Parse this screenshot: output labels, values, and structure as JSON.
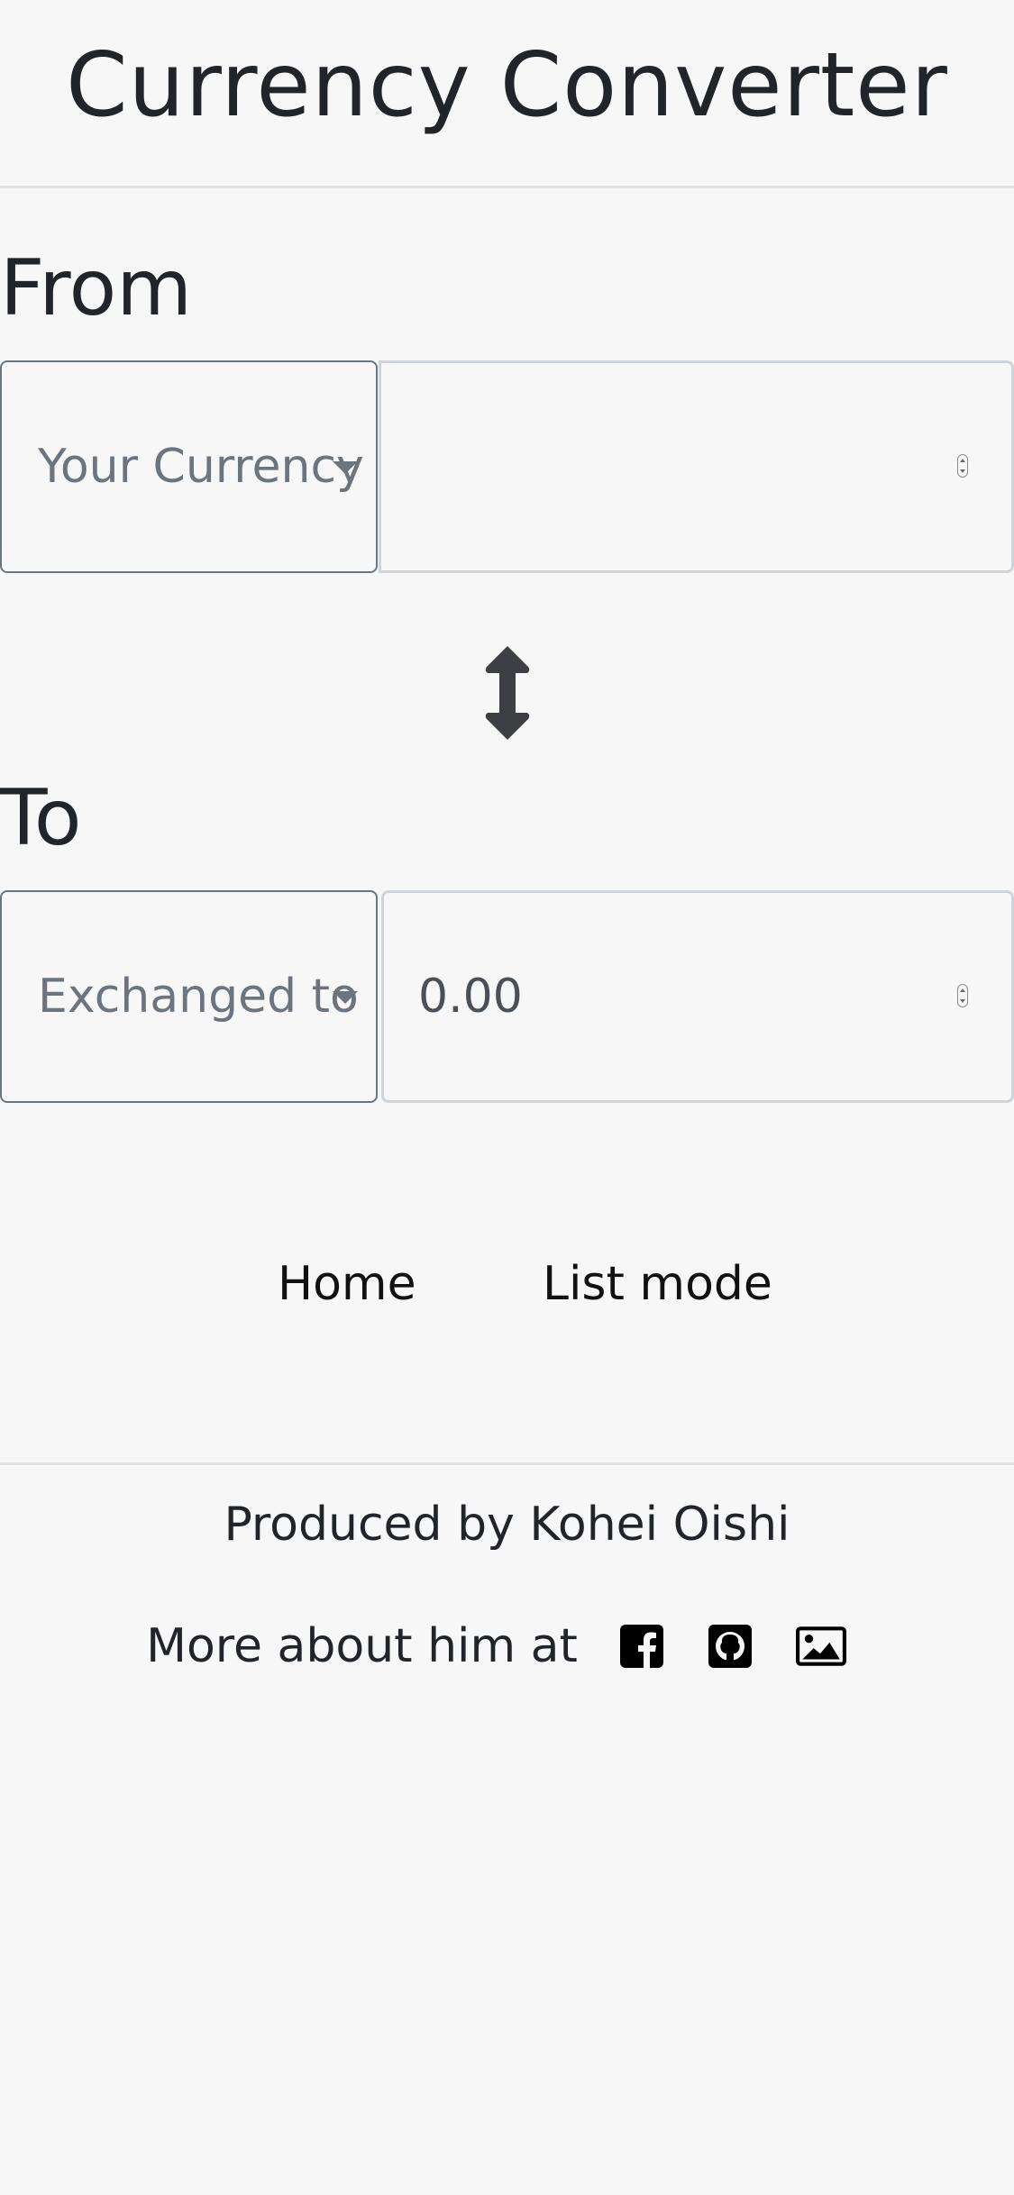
{
  "header": {
    "title": "Currency Converter"
  },
  "from": {
    "label": "From",
    "currency_dropdown": "Your Currency",
    "amount_value": ""
  },
  "swap": {
    "icon": "swap-vertical-arrows-icon"
  },
  "to": {
    "label": "To",
    "currency_dropdown": "Exchanged to",
    "amount_value": "0.00"
  },
  "nav": {
    "items": [
      {
        "label": "Home"
      },
      {
        "label": "List mode"
      }
    ]
  },
  "footer": {
    "produced_by": "Produced by Kohei Oishi",
    "more_about": "More about him at",
    "social_icons": [
      "facebook-icon",
      "github-icon",
      "image-gallery-icon"
    ]
  },
  "colors": {
    "background": "#f7f7f7",
    "text": "#212529",
    "muted": "#6c757d",
    "border": "#ced4da"
  }
}
